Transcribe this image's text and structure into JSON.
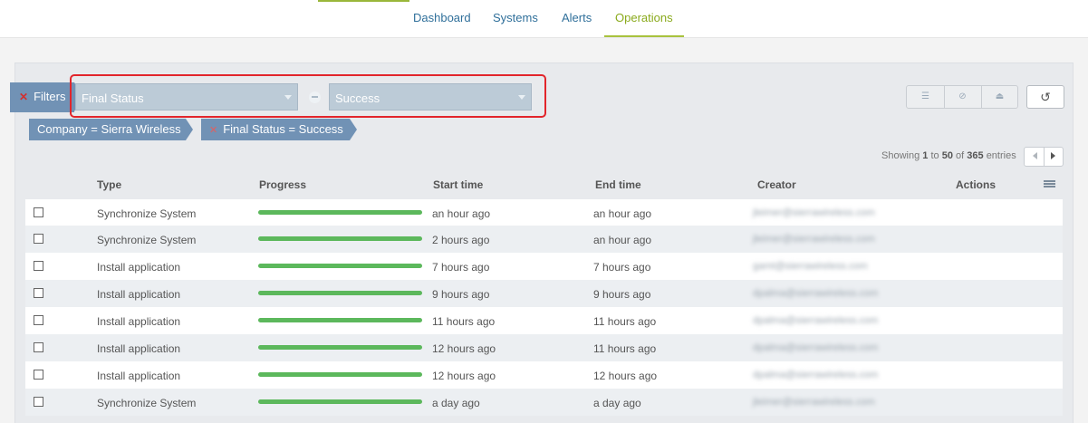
{
  "nav": {
    "tabs": [
      {
        "label": "Dashboard"
      },
      {
        "label": "Systems"
      },
      {
        "label": "Alerts"
      },
      {
        "label": "Operations"
      }
    ],
    "active_tab": "Operations"
  },
  "filters": {
    "label": "Filters",
    "field_select": "Final Status",
    "value_select": "Success",
    "chips": [
      "Company = Sierra Wireless",
      "Final Status = Success"
    ]
  },
  "pagination": {
    "showing_prefix": "Showing",
    "from": "1",
    "to_word": "to",
    "to": "50",
    "of_word": "of",
    "total": "365",
    "suffix": "entries"
  },
  "table": {
    "columns": [
      "Type",
      "Progress",
      "Start time",
      "End time",
      "Creator",
      "Actions"
    ],
    "rows": [
      {
        "type": "Synchronize System",
        "progress": 1.0,
        "start": "an hour ago",
        "end": "an hour ago",
        "creator": "jleimer@sierrawireless.com"
      },
      {
        "type": "Synchronize System",
        "progress": 1.0,
        "start": "2 hours ago",
        "end": "an hour ago",
        "creator": "jleimer@sierrawireless.com"
      },
      {
        "type": "Install application",
        "progress": 1.0,
        "start": "7 hours ago",
        "end": "7 hours ago",
        "creator": "gamt@sierrawireless.com"
      },
      {
        "type": "Install application",
        "progress": 1.0,
        "start": "9 hours ago",
        "end": "9 hours ago",
        "creator": "dpalma@sierrawireless.com"
      },
      {
        "type": "Install application",
        "progress": 1.0,
        "start": "11 hours ago",
        "end": "11 hours ago",
        "creator": "dpalma@sierrawireless.com"
      },
      {
        "type": "Install application",
        "progress": 1.0,
        "start": "12 hours ago",
        "end": "11 hours ago",
        "creator": "dpalma@sierrawireless.com"
      },
      {
        "type": "Install application",
        "progress": 1.0,
        "start": "12 hours ago",
        "end": "12 hours ago",
        "creator": "dpalma@sierrawireless.com"
      },
      {
        "type": "Synchronize System",
        "progress": 1.0,
        "start": "a day ago",
        "end": "a day ago",
        "creator": "jleimer@sierrawireless.com"
      }
    ]
  },
  "colors": {
    "accent": "#9ab73a",
    "link": "#2f6f9a",
    "filter_blue": "#7192b5",
    "progress_green": "#5cb85c",
    "highlight_red": "#e2252b"
  }
}
